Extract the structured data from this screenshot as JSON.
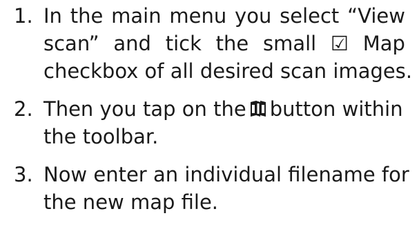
{
  "steps": [
    {
      "number": "1.",
      "line1": [
        "In",
        "the",
        "main",
        "menu",
        "you",
        "select",
        "“View"
      ],
      "line2": {
        "before": [
          "scan”",
          "and",
          "tick",
          "the",
          "small"
        ],
        "checkbox_glyph": "☑",
        "after": "Map"
      },
      "line3": "checkbox of all desired scan images."
    },
    {
      "number": "2.",
      "line1_before": "Then you tap on the",
      "icon": "map-book-icon",
      "line1_after": "button within",
      "line2": "the toolbar."
    },
    {
      "number": "3.",
      "line1": "Now enter an individual filename for",
      "line2": "the new map file."
    }
  ]
}
